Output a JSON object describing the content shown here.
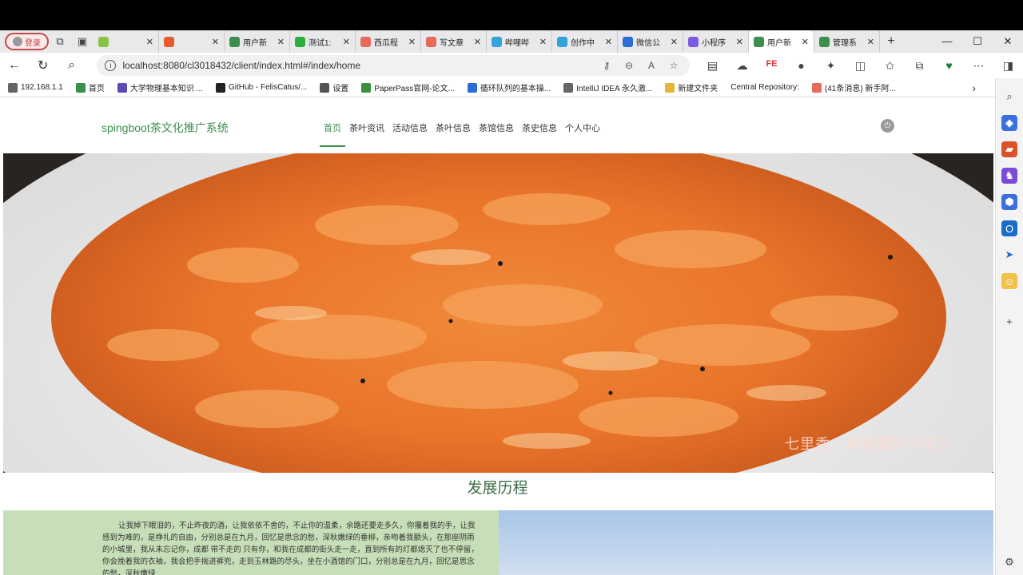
{
  "browser": {
    "profile_label": "登录",
    "tabs": [
      {
        "title": "",
        "icon": "shield-icon",
        "color": "#8bc34a"
      },
      {
        "title": "",
        "icon": "link-icon",
        "color": "#e65c2f"
      },
      {
        "title": "用户新",
        "icon": "vue-icon",
        "color": "#3a8f4a"
      },
      {
        "title": "测试1:",
        "icon": "wechat-icon",
        "color": "#2aae3d"
      },
      {
        "title": "西瓜程",
        "icon": "csdn-icon",
        "color": "#e86a5a"
      },
      {
        "title": "写文章",
        "icon": "csdn-icon",
        "color": "#e86a5a"
      },
      {
        "title": "哔哩哔",
        "icon": "bilibili-icon",
        "color": "#33a3dc"
      },
      {
        "title": "创作中",
        "icon": "bilibili-icon",
        "color": "#33a3dc"
      },
      {
        "title": "微信公",
        "icon": "search-icon",
        "color": "#2b6cd6"
      },
      {
        "title": "小程序",
        "icon": "mini-program-icon",
        "color": "#7b5ce0"
      },
      {
        "title": "用户新",
        "icon": "vue-icon",
        "color": "#3a8f4a",
        "active": true
      },
      {
        "title": "管理系",
        "icon": "vue-icon",
        "color": "#3a8f4a"
      }
    ],
    "url": "localhost:8080/cl3018432/client/index.html#/index/home",
    "bookmarks": [
      {
        "label": "192.168.1.1",
        "icon": "page-icon",
        "color": "#666"
      },
      {
        "label": "首页",
        "icon": "vue-icon",
        "color": "#3a8f4a"
      },
      {
        "label": "大学物理基本知识 ...",
        "icon": "star-icon",
        "color": "#5a4bb5"
      },
      {
        "label": "GitHub - FelisCatus/...",
        "icon": "github-icon",
        "color": "#222"
      },
      {
        "label": "设置",
        "icon": "gear-icon",
        "color": "#555"
      },
      {
        "label": "PaperPass官网-论文...",
        "icon": "pp-icon",
        "color": "#3e8e41"
      },
      {
        "label": "循环队列的基本操...",
        "icon": "badge-icon",
        "color": "#2b6cd6"
      },
      {
        "label": "IntelliJ IDEA 永久激...",
        "icon": "page-icon",
        "color": "#666"
      },
      {
        "label": "新建文件夹",
        "icon": "folder-icon",
        "color": "#e8b339"
      },
      {
        "label": "Central Repository:",
        "icon": "",
        "color": ""
      },
      {
        "label": "(41条消息) 新手阿...",
        "icon": "csdn-icon",
        "color": "#e86a5a"
      }
    ]
  },
  "site": {
    "brand": "spingboot茶文化推广系统",
    "menu": [
      "首页",
      "茶叶资讯",
      "活动信息",
      "茶叶信息",
      "茶馆信息",
      "茶史信息",
      "个人中心"
    ],
    "active_menu": "首页",
    "banner_watermark": "七里香 - 你需要的小青瓜",
    "section_title": "发展历程",
    "history_text": "让我掉下眼泪的，不止昨夜的酒，让我依依不舍的，不止你的温柔，余路还要走多久，你攥着我的手，让我感到为难的，是挣扎的自由，分别总是在九月，回忆是思念的愁，深秋嫩绿的垂柳，亲吻着我额头，在那座阴雨的小城里，我从未忘记你，成都 带不走的 只有你，和我在成都的街头走一走，直到所有的灯都熄灭了也不停留，你会挽着我的衣袖，我会把手揣进裤兜，走到玉林路的尽头，坐在小酒馆的门口，分别总是在九月，回忆是思念的愁，深秋嫩绿"
  }
}
